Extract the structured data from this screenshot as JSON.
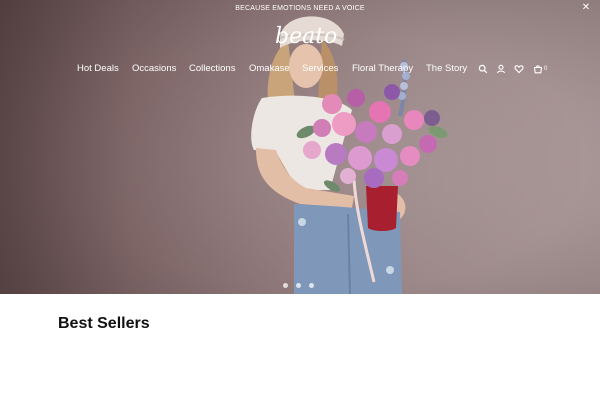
{
  "announcement": {
    "text": "BECAUSE EMOTIONS NEED A VOICE",
    "close_icon": "close-icon"
  },
  "brand": {
    "logo_text": "beato"
  },
  "nav": {
    "items": [
      {
        "label": "Hot Deals"
      },
      {
        "label": "Occasions"
      },
      {
        "label": "Collections"
      },
      {
        "label": "Omakase"
      },
      {
        "label": "Services"
      },
      {
        "label": "Floral Therapy"
      },
      {
        "label": "The Story"
      }
    ],
    "icons": [
      "search-icon",
      "account-icon",
      "wishlist-heart-icon",
      "cart-icon"
    ],
    "cart_count": "0"
  },
  "hero": {
    "slide_count": 3,
    "active_slide": 1,
    "image": "woman-holding-pink-and-purple-flower-bouquet"
  },
  "sections": {
    "best_sellers_title": "Best Sellers"
  },
  "colors": {
    "hero_bg": "#7d6566",
    "text_dark": "#111111",
    "nav_text": "#ffffff"
  }
}
